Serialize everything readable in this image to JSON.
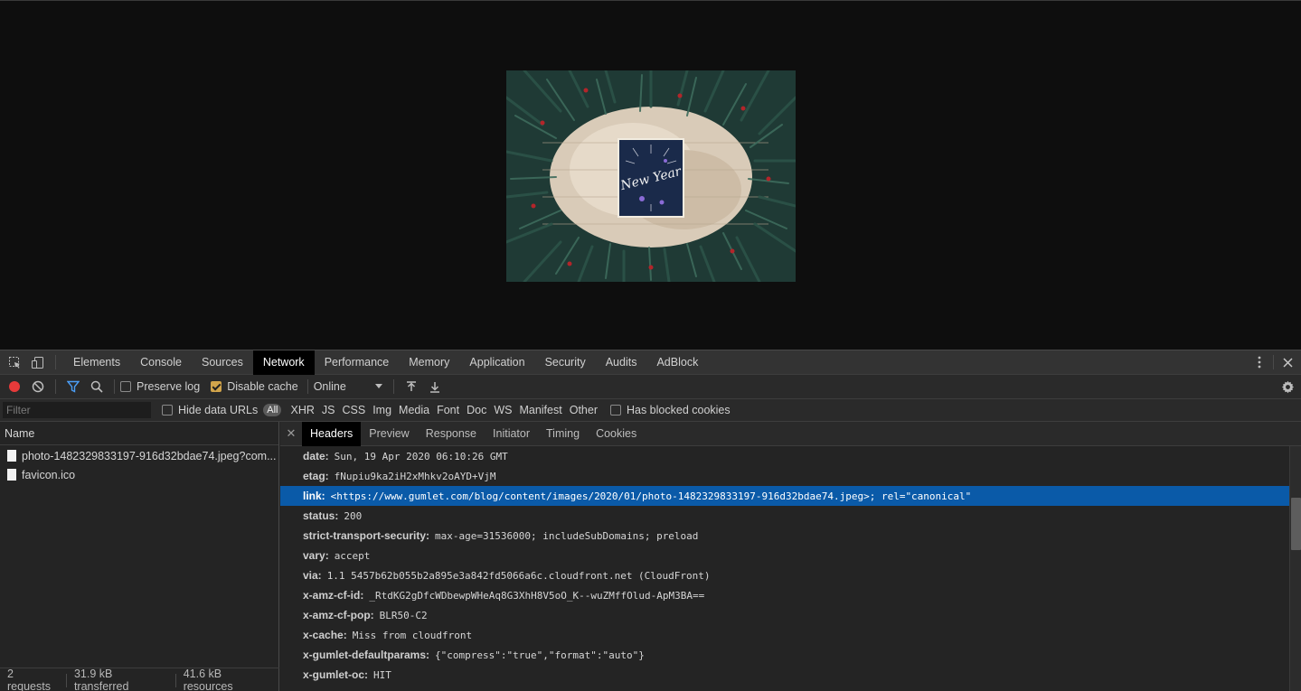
{
  "devtools": {
    "main_tabs": [
      {
        "label": "Elements"
      },
      {
        "label": "Console"
      },
      {
        "label": "Sources"
      },
      {
        "label": "Network",
        "active": true
      },
      {
        "label": "Performance"
      },
      {
        "label": "Memory"
      },
      {
        "label": "Application"
      },
      {
        "label": "Security"
      },
      {
        "label": "Audits"
      },
      {
        "label": "AdBlock"
      }
    ],
    "toolbar": {
      "preserve_log": {
        "label": "Preserve log",
        "checked": false
      },
      "disable_cache": {
        "label": "Disable cache",
        "checked": true
      },
      "throttle": {
        "value": "Online"
      }
    },
    "filterbar": {
      "filter_placeholder": "Filter",
      "hide_data_urls": {
        "label": "Hide data URLs",
        "checked": false
      },
      "types": [
        "All",
        "XHR",
        "JS",
        "CSS",
        "Img",
        "Media",
        "Font",
        "Doc",
        "WS",
        "Manifest",
        "Other"
      ],
      "has_blocked_cookies": {
        "label": "Has blocked cookies",
        "checked": false
      }
    },
    "requests_pane": {
      "column_header": "Name",
      "requests": [
        {
          "name": "photo-1482329833197-916d32bdae74.jpeg?com..."
        },
        {
          "name": "favicon.ico"
        }
      ],
      "status": {
        "requests": "2 requests",
        "transferred": "31.9 kB transferred",
        "resources": "41.6 kB resources"
      }
    },
    "detail_pane": {
      "tabs": [
        {
          "label": "Headers",
          "active": true
        },
        {
          "label": "Preview"
        },
        {
          "label": "Response"
        },
        {
          "label": "Initiator"
        },
        {
          "label": "Timing"
        },
        {
          "label": "Cookies"
        }
      ],
      "headers": [
        {
          "name": "date:",
          "value": "Sun, 19 Apr 2020 06:10:26 GMT"
        },
        {
          "name": "etag:",
          "value": "fNupiu9ka2iH2xMhkv2oAYD+VjM"
        },
        {
          "name": "link:",
          "value": "<https://www.gumlet.com/blog/content/images/2020/01/photo-1482329833197-916d32bdae74.jpeg>; rel=\"canonical\"",
          "selected": true
        },
        {
          "name": "status:",
          "value": "200"
        },
        {
          "name": "strict-transport-security:",
          "value": "max-age=31536000; includeSubDomains; preload"
        },
        {
          "name": "vary:",
          "value": "accept"
        },
        {
          "name": "via:",
          "value": "1.1 5457b62b055b2a895e3a842fd5066a6c.cloudfront.net (CloudFront)"
        },
        {
          "name": "x-amz-cf-id:",
          "value": "_RtdKG2gDfcWDbewpWHeAq8G3XhH8V5oO_K--wuZMffOlud-ApM3BA=="
        },
        {
          "name": "x-amz-cf-pop:",
          "value": "BLR50-C2"
        },
        {
          "name": "x-cache:",
          "value": "Miss from cloudfront"
        },
        {
          "name": "x-gumlet-defaultparams:",
          "value": "{\"compress\":\"true\",\"format\":\"auto\"}"
        },
        {
          "name": "x-gumlet-oc:",
          "value": "HIT"
        }
      ]
    }
  },
  "photo": {
    "card_text": "New Year",
    "colors": {
      "pine": "#1f3a35",
      "wood": "#d9cbb8",
      "card": "#1a2a4a",
      "berry": "#b3252a"
    }
  },
  "colors": {
    "record": "#e63a3a",
    "filter_active": "#4b9ef5",
    "checkbox_on": "#d1a44b",
    "selected_row": "#0a5aa8"
  }
}
